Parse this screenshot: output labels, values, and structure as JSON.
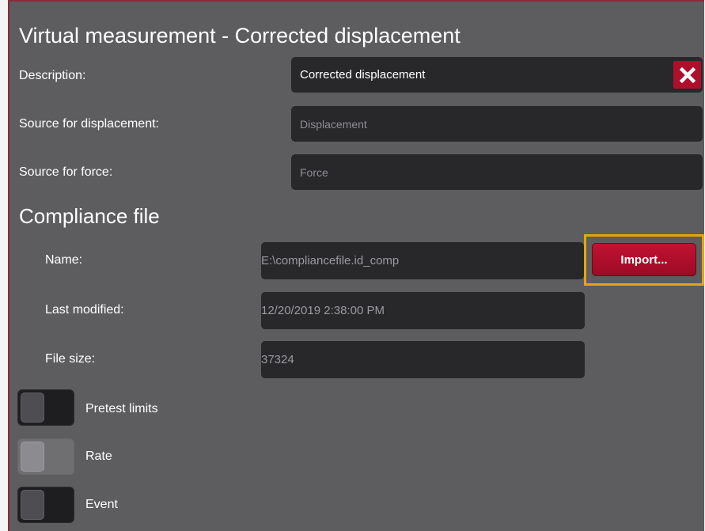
{
  "window": {
    "title": "Virtual measurement - Corrected displacement"
  },
  "form": {
    "description": {
      "label": "Description:",
      "value": "Corrected displacement",
      "clear_icon": "close-icon"
    },
    "source_displacement": {
      "label": "Source for displacement:",
      "value": "Displacement"
    },
    "source_force": {
      "label": "Source for force:",
      "value": "Force"
    }
  },
  "compliance": {
    "heading": "Compliance file",
    "name": {
      "label": "Name:",
      "value": "E:\\compliancefile.id_comp"
    },
    "import_label": "Import...",
    "last_modified": {
      "label": "Last modified:",
      "value": "12/20/2019 2:38:00 PM"
    },
    "file_size": {
      "label": "File size:",
      "value": "37324"
    }
  },
  "toggles": [
    {
      "label": "Pretest limits",
      "state": "off"
    },
    {
      "label": "Rate",
      "state": "disabled"
    },
    {
      "label": "Event",
      "state": "off"
    }
  ],
  "colors": {
    "panel_bg": "#5d5d60",
    "field_bg": "#28282b",
    "accent_red": "#ae0f2b",
    "highlight_orange": "#e8a40c",
    "panel_border": "#8a2a3e"
  }
}
